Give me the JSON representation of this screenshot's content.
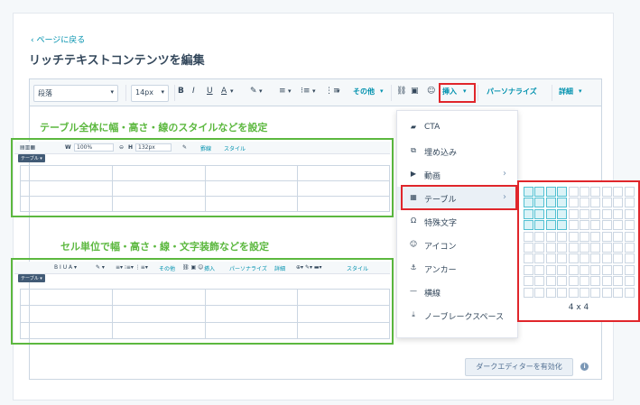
{
  "header": {
    "back_link": "‹ ページに戻る",
    "title": "リッチテキストコンテンツを編集"
  },
  "toolbar": {
    "paragraph": "段落",
    "font_size": "14px",
    "bold": "B",
    "italic": "I",
    "underline": "U",
    "color": "A",
    "more": "その他",
    "insert": "挿入",
    "personalize": "パーソナライズ",
    "details": "詳細"
  },
  "annotations": {
    "table_level": "テーブル全体に幅・高さ・線のスタイルなどを設定",
    "cell_level": "セル単位で幅・高さ・線・文字装飾などを設定"
  },
  "mini1": {
    "width_label": "W",
    "width_value": "100%",
    "height_label": "H",
    "height_value": "132px",
    "border": "罫線",
    "style": "スタイル",
    "tag": "テーブル"
  },
  "mini2": {
    "more": "その他",
    "insert": "挿入",
    "personalize": "パーソナライズ",
    "details": "詳細",
    "style": "スタイル",
    "tag": "テーブル"
  },
  "insert_menu": {
    "items": [
      {
        "label": "CTA",
        "icon": "cta-icon",
        "submenu": false
      },
      {
        "label": "埋め込み",
        "icon": "embed-icon",
        "submenu": false
      },
      {
        "label": "動画",
        "icon": "video-icon",
        "submenu": true
      },
      {
        "label": "テーブル",
        "icon": "table-icon",
        "submenu": true
      },
      {
        "label": "特殊文字",
        "icon": "omega-icon",
        "submenu": false
      },
      {
        "label": "アイコン",
        "icon": "icon-icon",
        "submenu": false
      },
      {
        "label": "アンカー",
        "icon": "anchor-icon",
        "submenu": false
      },
      {
        "label": "横線",
        "icon": "hr-icon",
        "submenu": false
      },
      {
        "label": "ノーブレークスペース",
        "icon": "nbsp-icon",
        "submenu": false
      }
    ]
  },
  "table_picker": {
    "rows": 10,
    "cols": 10,
    "selected_rows": 4,
    "selected_cols": 4,
    "label": "4 x 4"
  },
  "footer": {
    "dark_editor_button": "ダークエディターを有効化"
  },
  "colors": {
    "accent": "#0091ae",
    "highlight_red": "#e0262b",
    "annotation_green": "#5cb83f"
  }
}
